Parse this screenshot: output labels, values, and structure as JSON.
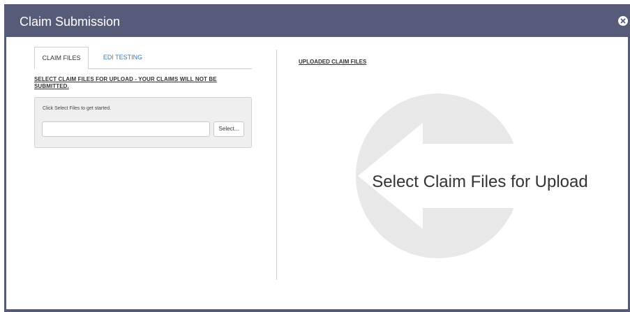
{
  "dialog": {
    "title": "Claim Submission",
    "close_icon": "close-circle-icon"
  },
  "left": {
    "tabs": [
      {
        "label": "CLAIM FILES",
        "active": true
      },
      {
        "label": "EDI TESTING",
        "active": false
      }
    ],
    "notice": "SELECT CLAIM FILES FOR UPLOAD - YOUR CLAIMS WILL NOT BE SUBMITTED.",
    "upload": {
      "hint": "Click Select Files to get started.",
      "file_value": "",
      "select_label": "Select..."
    }
  },
  "right": {
    "header": "UPLOADED CLAIM FILES",
    "placeholder_text": "Select Claim Files for Upload",
    "placeholder_icon": "left-arrow-circle-icon"
  },
  "colors": {
    "titlebar": "#565b7a",
    "tab_link": "#3a78b5",
    "watermark": "#e8e8e8"
  }
}
